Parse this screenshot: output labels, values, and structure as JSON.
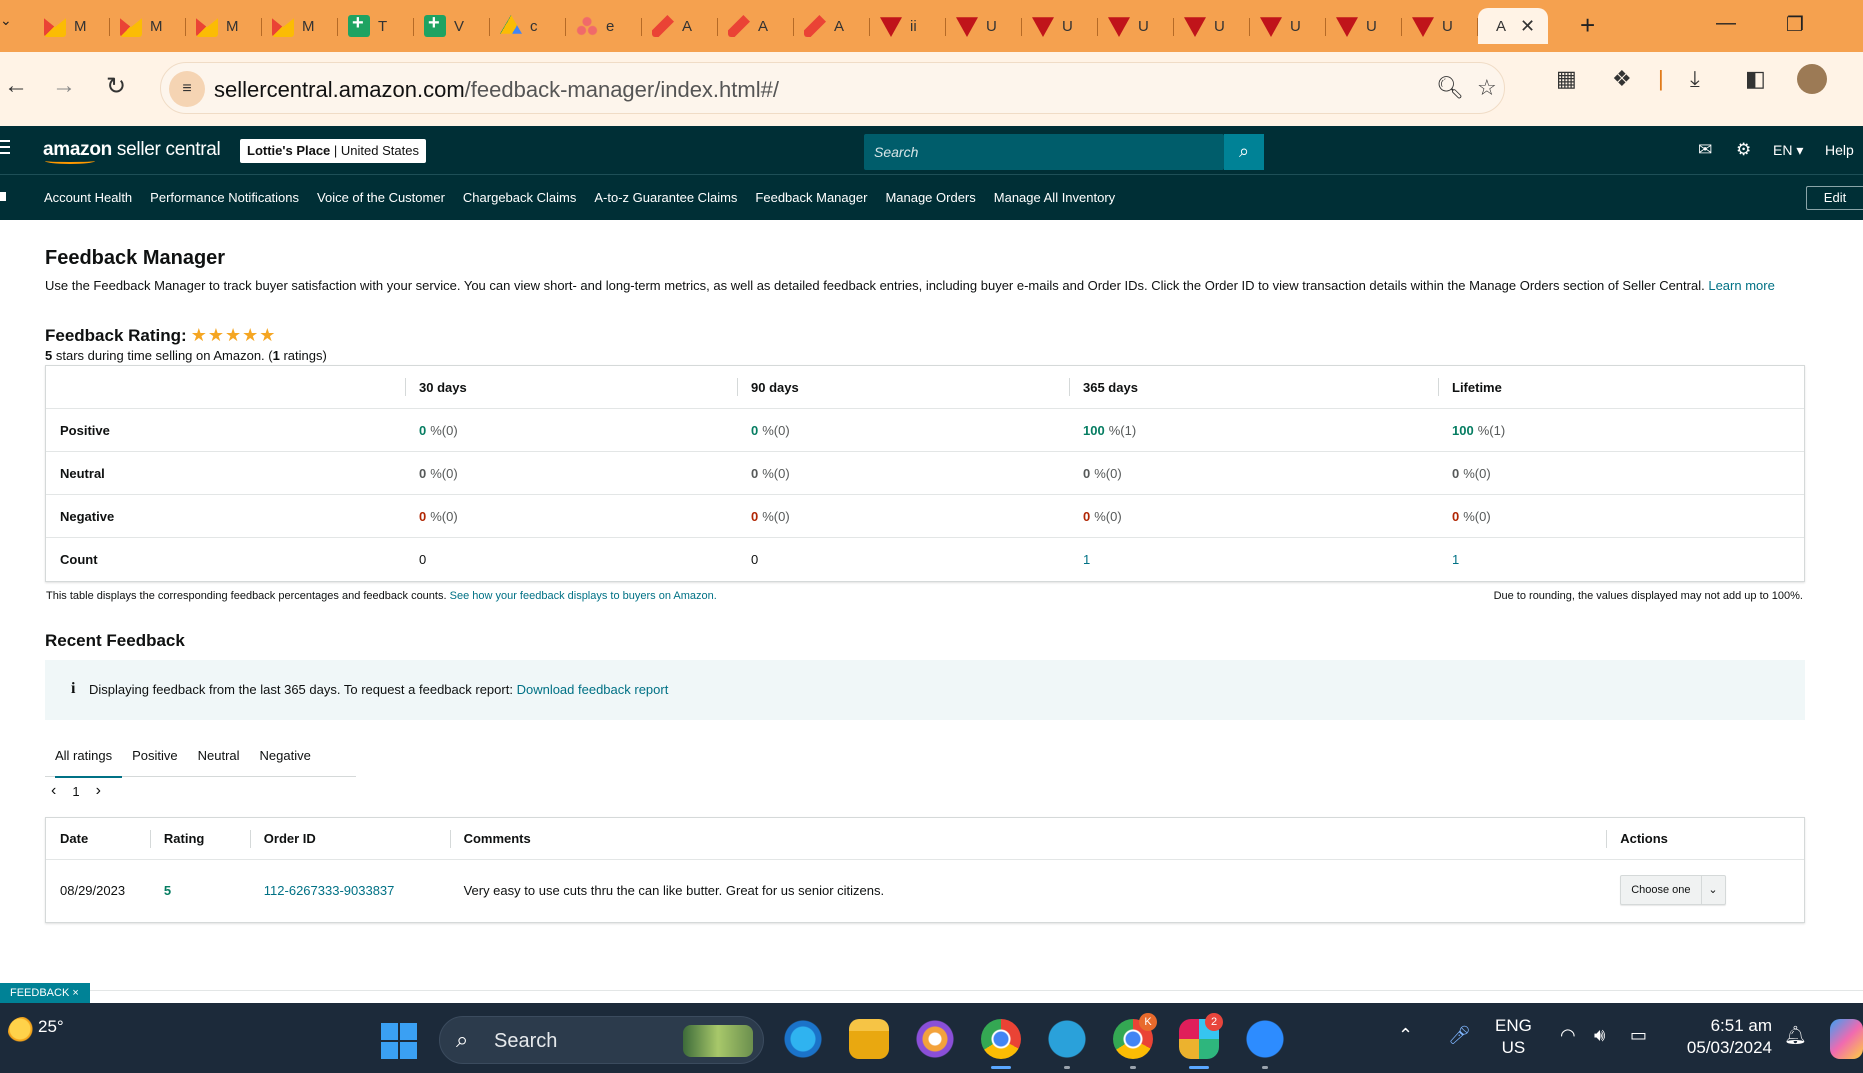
{
  "browser": {
    "tabs": [
      {
        "icon": "gmail-icon",
        "title": "M"
      },
      {
        "icon": "gmail-icon",
        "title": "M"
      },
      {
        "icon": "gmail-icon",
        "title": "M"
      },
      {
        "icon": "gmail-icon",
        "title": "M"
      },
      {
        "icon": "sheets-icon",
        "title": "T"
      },
      {
        "icon": "sheets-icon",
        "title": "V"
      },
      {
        "icon": "drive-icon",
        "title": "c"
      },
      {
        "icon": "asana-icon",
        "title": "e"
      },
      {
        "icon": "pencil-app-icon",
        "title": "A"
      },
      {
        "icon": "pencil-app-icon",
        "title": "A"
      },
      {
        "icon": "pencil-app-icon",
        "title": "A"
      },
      {
        "icon": "red-triangle-icon",
        "title": "ii"
      },
      {
        "icon": "red-triangle-icon",
        "title": "U"
      },
      {
        "icon": "red-triangle-icon",
        "title": "U"
      },
      {
        "icon": "red-triangle-icon",
        "title": "U"
      },
      {
        "icon": "red-triangle-icon",
        "title": "U"
      },
      {
        "icon": "red-triangle-icon",
        "title": "U"
      },
      {
        "icon": "red-triangle-icon",
        "title": "U"
      },
      {
        "icon": "red-triangle-icon",
        "title": "U"
      }
    ],
    "active_tab_title": "A",
    "url_domain": "sellercentral.amazon.com",
    "url_path": "/feedback-manager/index.html#/"
  },
  "header": {
    "logo_bold": "amazon",
    "logo_rest": " seller central",
    "store_name": "Lottie's Place",
    "store_region": "United States",
    "search_placeholder": "Search",
    "language": "EN",
    "help": "Help"
  },
  "nav": {
    "items": [
      "Account Health",
      "Performance Notifications",
      "Voice of the Customer",
      "Chargeback Claims",
      "A-to-z Guarantee Claims",
      "Feedback Manager",
      "Manage Orders",
      "Manage All Inventory"
    ],
    "edit": "Edit"
  },
  "page": {
    "title": "Feedback Manager",
    "intro": "Use the Feedback Manager to track buyer satisfaction with your service. You can view short- and long-term metrics, as well as detailed feedback entries, including buyer e-mails and Order IDs. Click the Order ID to view transaction details within the Manage Orders section of Seller Central.",
    "learn_more": "Learn more",
    "rating_title": "Feedback Rating:",
    "rating_stars": 5,
    "rating_value": "5",
    "rating_mid": " stars during time selling on Amazon. (",
    "rating_count": "1",
    "rating_end": " ratings)"
  },
  "feedback_table": {
    "columns": [
      "30 days",
      "90 days",
      "365 days",
      "Lifetime"
    ],
    "rows": {
      "positive": {
        "label": "Positive",
        "values": [
          {
            "pct": "0",
            "cnt": " %(0)"
          },
          {
            "pct": "0",
            "cnt": " %(0)"
          },
          {
            "pct": "100",
            "cnt": " %(1)"
          },
          {
            "pct": "100",
            "cnt": " %(1)"
          }
        ]
      },
      "neutral": {
        "label": "Neutral",
        "values": [
          {
            "pct": "0",
            "cnt": " %(0)"
          },
          {
            "pct": "0",
            "cnt": " %(0)"
          },
          {
            "pct": "0",
            "cnt": " %(0)"
          },
          {
            "pct": "0",
            "cnt": " %(0)"
          }
        ]
      },
      "negative": {
        "label": "Negative",
        "values": [
          {
            "pct": "0",
            "cnt": " %(0)"
          },
          {
            "pct": "0",
            "cnt": " %(0)"
          },
          {
            "pct": "0",
            "cnt": " %(0)"
          },
          {
            "pct": "0",
            "cnt": " %(0)"
          }
        ]
      },
      "count": {
        "label": "Count",
        "values": [
          "0",
          "0",
          "1",
          "1"
        ]
      }
    },
    "note": "This table displays the corresponding feedback percentages and feedback counts.",
    "note_link": "See how your feedback displays to buyers on Amazon.",
    "rounding_note": "Due to rounding, the values displayed may not add up to 100%."
  },
  "recent": {
    "title": "Recent Feedback",
    "info_text": "Displaying feedback from the last 365 days. To request a feedback report:",
    "info_link": "Download feedback report",
    "filters": [
      "All ratings",
      "Positive",
      "Neutral",
      "Negative"
    ],
    "page": "1",
    "columns": [
      "Date",
      "Rating",
      "Order ID",
      "Comments",
      "Actions"
    ],
    "rows": [
      {
        "date": "08/29/2023",
        "rating": "5",
        "order_id": "112-6267333-9033837",
        "comment": "Very easy to use cuts thru the can like butter. Great for us senior citizens.",
        "action": "Choose one"
      }
    ]
  },
  "feedback_tag": "FEEDBACK ×",
  "taskbar": {
    "temperature": "25°",
    "search": "Search",
    "lang_1": "ENG",
    "lang_2": "US",
    "time": "6:51 am",
    "date": "05/03/2024",
    "slack_badge": "2",
    "chrome_badge": "K"
  }
}
